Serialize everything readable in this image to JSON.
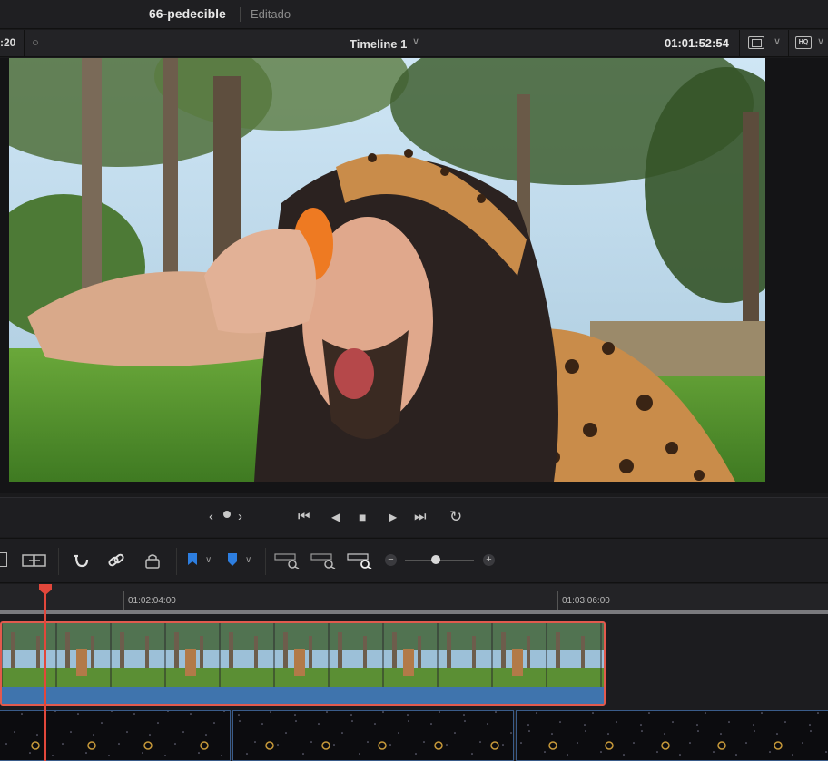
{
  "titlebar": {
    "project_name": "66-pedecible",
    "status": "Editado"
  },
  "viewer": {
    "timecode_left": ":20",
    "timeline_name": "Timeline 1",
    "timecode_right": "01:01:52:54"
  },
  "icons": {
    "chevron": "∨",
    "fullscreen": "fullscreen-icon",
    "hq": "HQ"
  },
  "transport": {
    "prev_clip": "‹",
    "next_clip": "›",
    "jump_start": "⏮",
    "step_back": "◀",
    "stop": "■",
    "play": "▶",
    "jump_end": "⏭",
    "loop": "↻"
  },
  "toolbar": {
    "zoom_minus": "−",
    "zoom_plus": "+",
    "zoom_level": 0.45
  },
  "ruler": {
    "labels": [
      "01:02:04:00",
      "01:03:06:00"
    ]
  },
  "colors": {
    "accent_red": "#e2473b",
    "clip_blue": "#3f74ad",
    "marker_blue": "#2d7ee0"
  }
}
